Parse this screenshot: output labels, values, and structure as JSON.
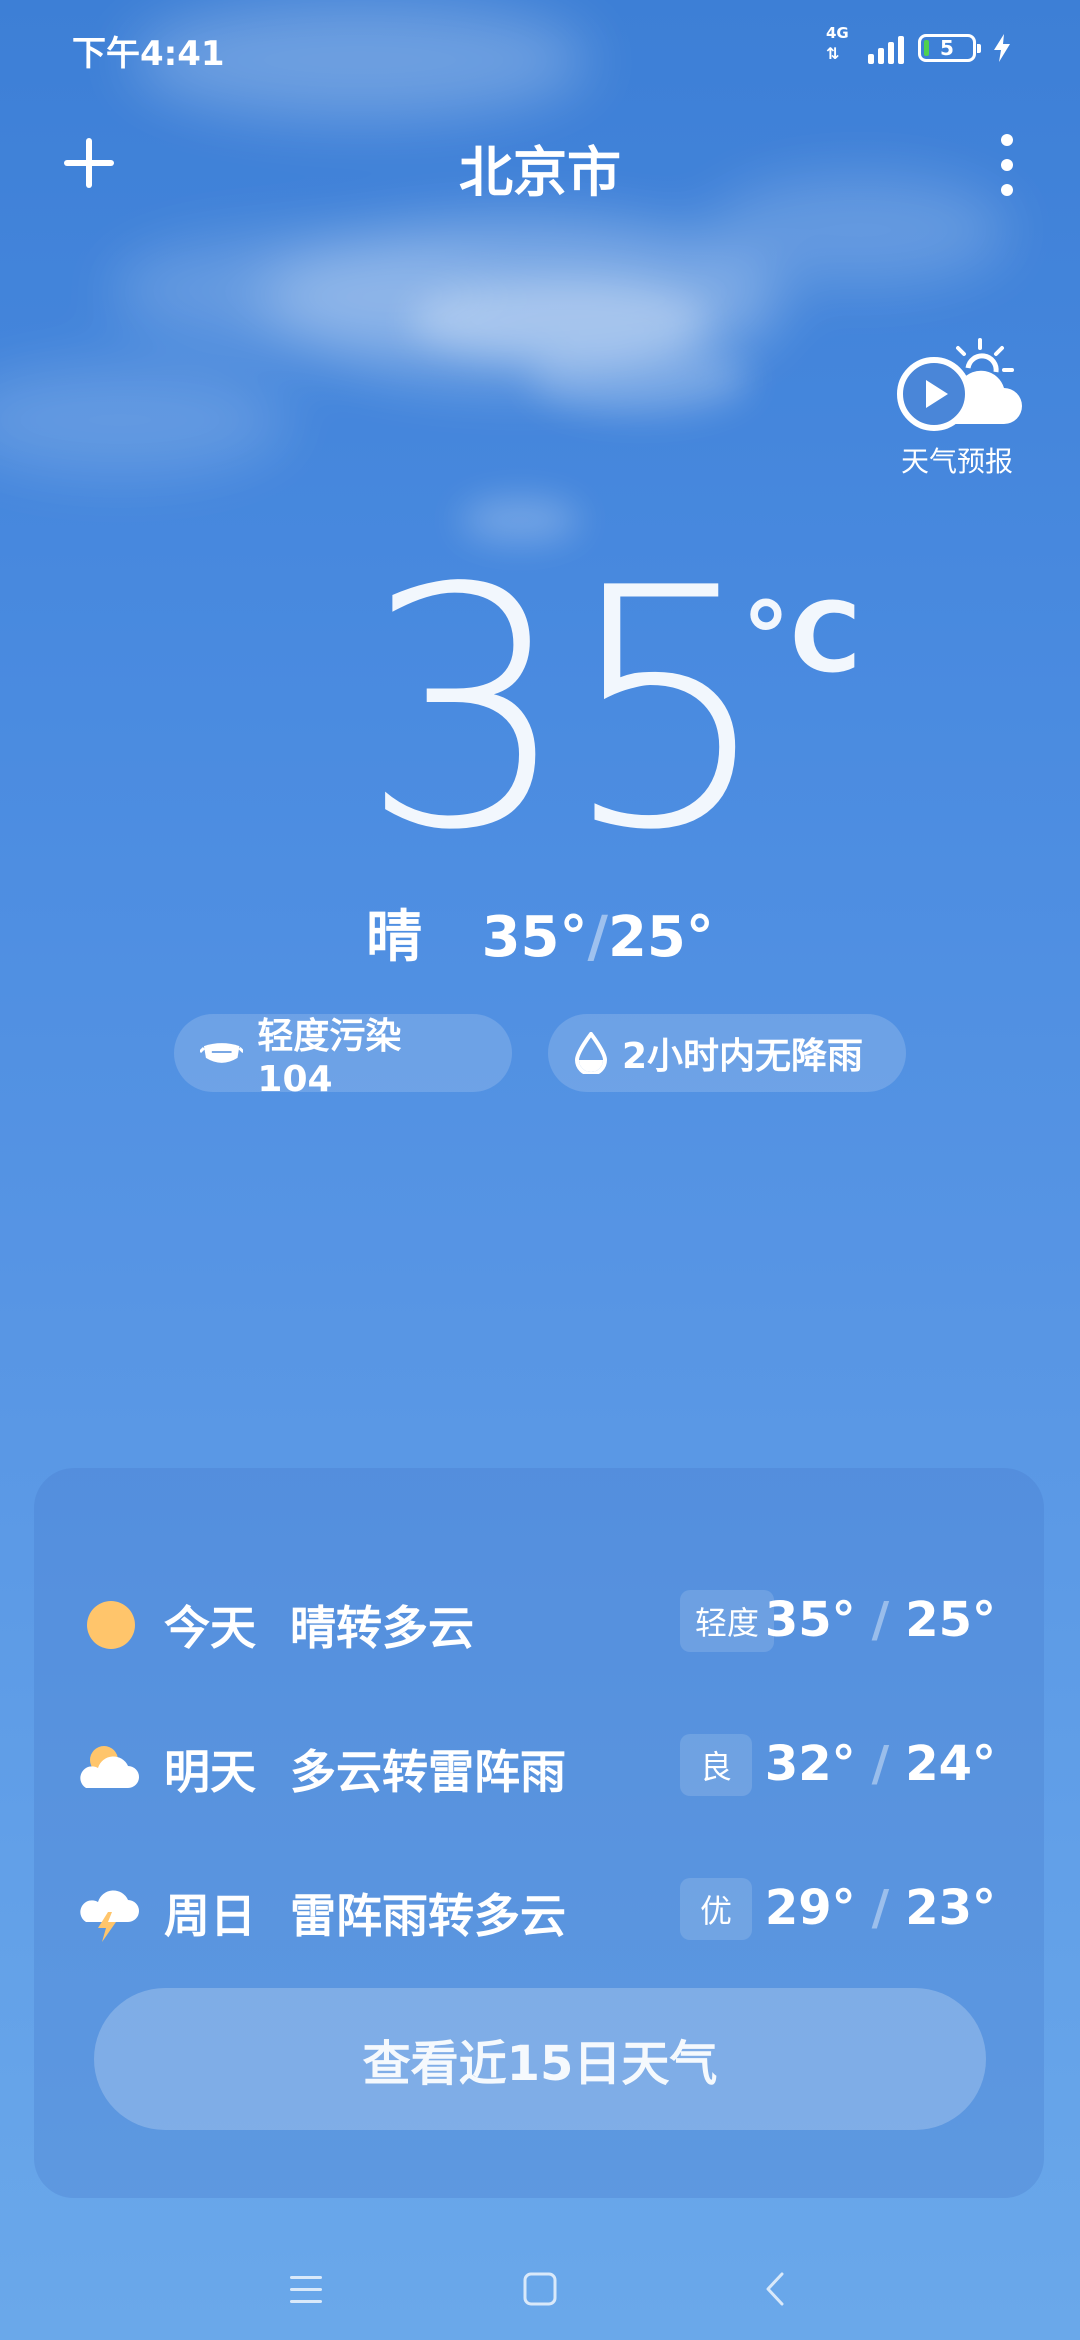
{
  "status_bar": {
    "time": "下午4:41",
    "network": "4G",
    "battery_level": "5",
    "icons": [
      "signal-icon",
      "battery-icon",
      "charging-icon"
    ]
  },
  "header": {
    "city": "北京市",
    "icons": [
      "add-icon",
      "more-vert-icon"
    ]
  },
  "forecast_video": {
    "label": "天气预报",
    "icon": "play-cloud-icon"
  },
  "current": {
    "temperature": "35",
    "unit": "°C",
    "condition": "晴",
    "high": "35°",
    "low": "25°",
    "separator": "/"
  },
  "chips": {
    "aqi": {
      "text": "轻度污染 104",
      "icon": "mask-icon"
    },
    "rain": {
      "text": "2小时内无降雨",
      "icon": "raindrop-icon"
    }
  },
  "forecast": [
    {
      "day": "今天",
      "condition": "晴转多云",
      "aqi": "轻度",
      "high": "35°",
      "low": "25°",
      "icon": "sun-icon"
    },
    {
      "day": "明天",
      "condition": "多云转雷阵雨",
      "aqi": "良",
      "high": "32°",
      "low": "24°",
      "icon": "partly-cloudy-icon"
    },
    {
      "day": "周日",
      "condition": "雷阵雨转多云",
      "aqi": "优",
      "high": "29°",
      "low": "23°",
      "icon": "thunderstorm-icon"
    }
  ],
  "more_button": "查看近15日天气",
  "temp_separator": "/",
  "colors": {
    "background_top": "#3d7fd6",
    "background_bottom": "#6aa8ea",
    "sun": "#ffc56b"
  },
  "navbar": {
    "icons": [
      "menu-icon",
      "home-icon",
      "back-icon"
    ]
  }
}
